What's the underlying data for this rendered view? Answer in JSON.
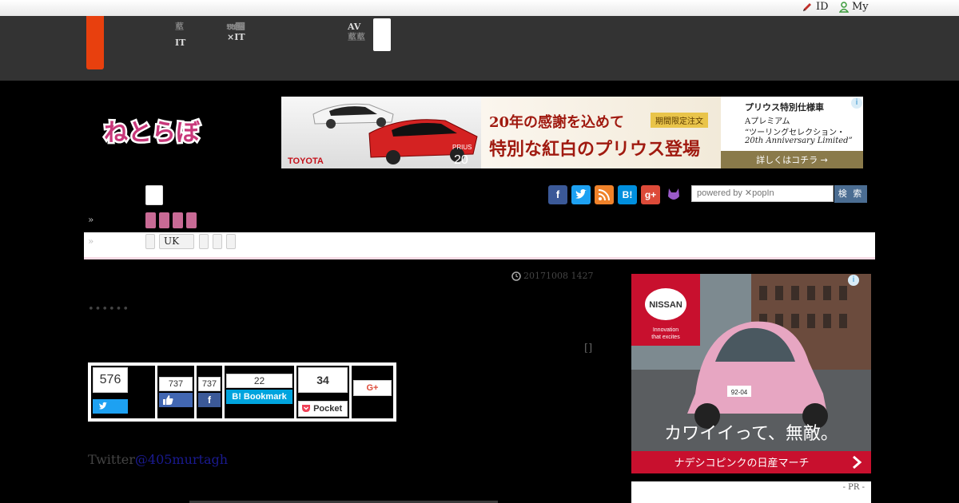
{
  "util": {
    "id_label": "ID",
    "my_label": "My"
  },
  "nav": {
    "item1_line1": "𦸃",
    "item1_line2": "IT",
    "item2_line1": "𝔅𝔄𝔆",
    "item2_line2": "×IT",
    "item3_line1": "AV",
    "item3_line2": "𦸃𦸃"
  },
  "logo_text": "ねとらぼ",
  "banner": {
    "headline1": "20年の感謝を込めて",
    "headline2": "特別な紅白のプリウス登場",
    "badge": "期間限定注文",
    "brand": "TOYOTA",
    "model": "PRIUS",
    "model_num": "20",
    "right_title": "プリウス特別仕様車",
    "right_line1": "Aプレミアム",
    "right_line2": "“ツーリングセレクション・",
    "right_line3": "20th Anniversary Limited”",
    "cta": "詳しくはコチラ →"
  },
  "search": {
    "placeholder": "powered by ✕popIn",
    "button": "検 索"
  },
  "breadcrumb": {
    "chev1": "»",
    "chev2": "»",
    "tag_uk": "UK"
  },
  "article": {
    "timestamp": "20171008 1427",
    "dots": "••••••",
    "bracket": "[]",
    "twitter_prefix": "Twitter",
    "twitter_handle": "@405murtagh"
  },
  "share": {
    "tweet_count": "576",
    "like_count": "737",
    "fb_count": "737",
    "hatena_count": "22",
    "hatena_label": "B! Bookmark",
    "pocket_count": "34",
    "pocket_label": "Pocket",
    "gplus_label": "G+"
  },
  "side_ad": {
    "brand": "NISSAN",
    "tagline1": "Innovation",
    "tagline2": "that excites",
    "plate": "92-04",
    "headline": "カワイイって、無敵。",
    "cta": "ナデシコピンクの日産マーチ",
    "pr": "- PR -"
  },
  "colors": {
    "accent": "#e8400e",
    "nav_bg": "#333333",
    "pink": "#c86a95",
    "twitter": "#1da1f2",
    "facebook": "#3b5998",
    "hatena": "#00a4de",
    "pocket": "#ef4056"
  }
}
